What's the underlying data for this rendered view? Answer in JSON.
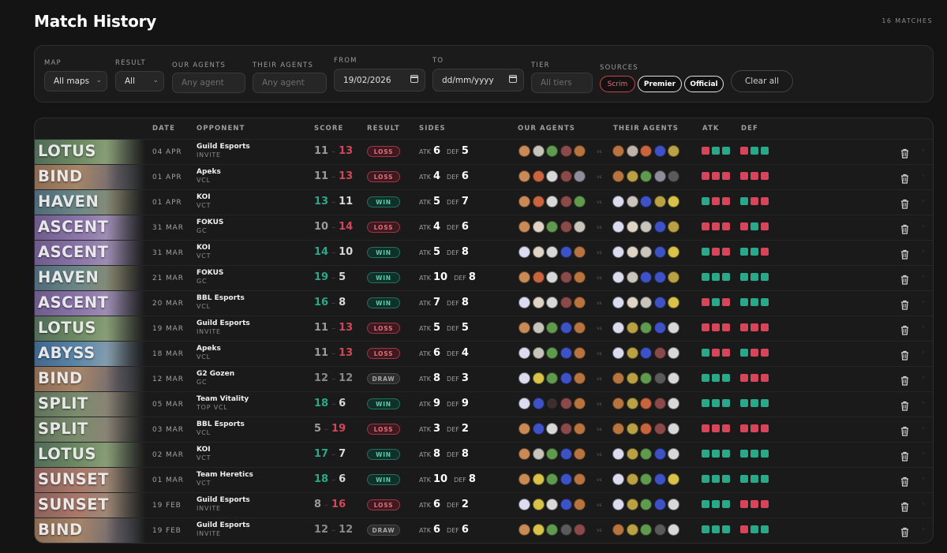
{
  "header": {
    "title": "Match History",
    "match_count": "16 MATCHES"
  },
  "filters": {
    "map_label": "MAP",
    "map_value": "All maps",
    "result_label": "RESULT",
    "result_value": "All",
    "our_agents_label": "OUR AGENTS",
    "our_agents_placeholder": "Any agent",
    "their_agents_label": "THEIR AGENTS",
    "their_agents_placeholder": "Any agent",
    "from_label": "FROM",
    "from_value": "19/02/2026",
    "to_label": "TO",
    "to_placeholder": "dd/mm/yyyy",
    "tier_label": "TIER",
    "tier_placeholder": "All tiers",
    "sources_label": "SOURCES",
    "sources": [
      "Scrim",
      "Premier",
      "Official"
    ],
    "clear_label": "Clear all"
  },
  "columns": {
    "date": "DATE",
    "opponent": "OPPONENT",
    "score": "SCORE",
    "result": "RESULT",
    "sides": "SIDES",
    "our_agents": "OUR AGENTS",
    "their_agents": "THEIR AGENTS",
    "atk": "ATK",
    "def": "DEF"
  },
  "labels": {
    "atk": "ATK",
    "def": "DEF",
    "vs": "vs"
  },
  "colors": {
    "win": "#2aa98a",
    "loss": "#d64559",
    "neutral": "#8a8a8a"
  },
  "matches": [
    {
      "map": "LOTUS",
      "date": "04 APR",
      "opponent": "Guild Esports",
      "league": "INVITE",
      "our": 11,
      "their": 13,
      "result": "LOSS",
      "atk": 6,
      "def": 5,
      "our_agents": [
        "C",
        "K",
        "S",
        "O",
        "B"
      ],
      "their_agents": [
        "B",
        "R",
        "F",
        "N",
        "G"
      ],
      "atk_rounds": "LWW",
      "def_rounds": "LWW"
    },
    {
      "map": "BIND",
      "date": "01 APR",
      "opponent": "Apeks",
      "league": "VCL",
      "our": 11,
      "their": 13,
      "result": "LOSS",
      "atk": 4,
      "def": 6,
      "our_agents": [
        "C",
        "F",
        "W",
        "O",
        "M"
      ],
      "their_agents": [
        "B",
        "G",
        "S",
        "M",
        "T"
      ],
      "atk_rounds": "LLL",
      "def_rounds": "LLL"
    },
    {
      "map": "HAVEN",
      "date": "01 APR",
      "opponent": "KOI",
      "league": "VCT",
      "our": 13,
      "their": 11,
      "result": "WIN",
      "atk": 5,
      "def": 7,
      "our_agents": [
        "C",
        "F",
        "W",
        "O",
        "S"
      ],
      "their_agents": [
        "J",
        "K",
        "N",
        "G",
        "Y"
      ],
      "atk_rounds": "WLL",
      "def_rounds": "WLL"
    },
    {
      "map": "ASCENT",
      "date": "31 MAR",
      "opponent": "FOKUS",
      "league": "GC",
      "our": 10,
      "their": 14,
      "result": "LOSS",
      "atk": 4,
      "def": 6,
      "our_agents": [
        "C",
        "E",
        "S",
        "O",
        "K"
      ],
      "their_agents": [
        "J",
        "E",
        "K",
        "N",
        "G"
      ],
      "atk_rounds": "LLL",
      "def_rounds": "LWL"
    },
    {
      "map": "ASCENT",
      "date": "31 MAR",
      "opponent": "KOI",
      "league": "VCT",
      "our": 14,
      "their": 10,
      "result": "WIN",
      "atk": 5,
      "def": 8,
      "our_agents": [
        "J",
        "E",
        "W",
        "N",
        "B"
      ],
      "their_agents": [
        "J",
        "E",
        "K",
        "N",
        "Y"
      ],
      "atk_rounds": "WLL",
      "def_rounds": "WWL"
    },
    {
      "map": "HAVEN",
      "date": "21 MAR",
      "opponent": "FOKUS",
      "league": "GC",
      "our": 19,
      "their": 5,
      "result": "WIN",
      "atk": 10,
      "def": 8,
      "our_agents": [
        "C",
        "F",
        "W",
        "O",
        "B"
      ],
      "their_agents": [
        "J",
        "K",
        "N",
        "N",
        "G"
      ],
      "atk_rounds": "WWW",
      "def_rounds": "WWW"
    },
    {
      "map": "ASCENT",
      "date": "20 MAR",
      "opponent": "BBL Esports",
      "league": "VCL",
      "our": 16,
      "their": 8,
      "result": "WIN",
      "atk": 7,
      "def": 8,
      "our_agents": [
        "J",
        "E",
        "W",
        "O",
        "B"
      ],
      "their_agents": [
        "J",
        "E",
        "K",
        "N",
        "Y"
      ],
      "atk_rounds": "LWL",
      "def_rounds": "WWW"
    },
    {
      "map": "LOTUS",
      "date": "19 MAR",
      "opponent": "Guild Esports",
      "league": "INVITE",
      "our": 11,
      "their": 13,
      "result": "LOSS",
      "atk": 5,
      "def": 5,
      "our_agents": [
        "C",
        "K",
        "S",
        "N",
        "B"
      ],
      "their_agents": [
        "J",
        "G",
        "S",
        "N",
        "W"
      ],
      "atk_rounds": "LLL",
      "def_rounds": "LLL"
    },
    {
      "map": "ABYSS",
      "date": "18 MAR",
      "opponent": "Apeks",
      "league": "VCL",
      "our": 11,
      "their": 13,
      "result": "LOSS",
      "atk": 6,
      "def": 4,
      "our_agents": [
        "J",
        "K",
        "S",
        "N",
        "B"
      ],
      "their_agents": [
        "J",
        "G",
        "N",
        "O",
        "W"
      ],
      "atk_rounds": "WLL",
      "def_rounds": "WLL"
    },
    {
      "map": "BIND",
      "date": "12 MAR",
      "opponent": "G2 Gozen",
      "league": "GC",
      "our": 12,
      "their": 12,
      "result": "DRAW",
      "atk": 8,
      "def": 3,
      "our_agents": [
        "J",
        "Y",
        "S",
        "N",
        "B"
      ],
      "their_agents": [
        "B",
        "G",
        "S",
        "T",
        "W"
      ],
      "atk_rounds": "WWW",
      "def_rounds": "LLL"
    },
    {
      "map": "SPLIT",
      "date": "05 MAR",
      "opponent": "Team Vitality",
      "league": "TOP VCL",
      "our": 18,
      "their": 6,
      "result": "WIN",
      "atk": 9,
      "def": 9,
      "our_agents": [
        "J",
        "N",
        "A",
        "O",
        "B"
      ],
      "their_agents": [
        "B",
        "G",
        "F",
        "O",
        "W"
      ],
      "atk_rounds": "WWW",
      "def_rounds": "WWW"
    },
    {
      "map": "SPLIT",
      "date": "03 MAR",
      "opponent": "BBL Esports",
      "league": "VCL",
      "our": 5,
      "their": 19,
      "result": "LOSS",
      "atk": 3,
      "def": 2,
      "our_agents": [
        "C",
        "N",
        "W",
        "O",
        "B"
      ],
      "their_agents": [
        "B",
        "G",
        "F",
        "O",
        "W"
      ],
      "atk_rounds": "LLL",
      "def_rounds": "LLL"
    },
    {
      "map": "LOTUS",
      "date": "02 MAR",
      "opponent": "KOI",
      "league": "VCT",
      "our": 17,
      "their": 7,
      "result": "WIN",
      "atk": 8,
      "def": 8,
      "our_agents": [
        "C",
        "K",
        "S",
        "N",
        "B"
      ],
      "their_agents": [
        "J",
        "G",
        "S",
        "N",
        "W"
      ],
      "atk_rounds": "WWW",
      "def_rounds": "WWW"
    },
    {
      "map": "SUNSET",
      "date": "01 MAR",
      "opponent": "Team Heretics",
      "league": "VCT",
      "our": 18,
      "their": 6,
      "result": "WIN",
      "atk": 10,
      "def": 8,
      "our_agents": [
        "C",
        "Y",
        "S",
        "N",
        "B"
      ],
      "their_agents": [
        "J",
        "G",
        "S",
        "N",
        "Y"
      ],
      "atk_rounds": "WWW",
      "def_rounds": "WWW"
    },
    {
      "map": "SUNSET",
      "date": "19 FEB",
      "opponent": "Guild Esports",
      "league": "INVITE",
      "our": 8,
      "their": 16,
      "result": "LOSS",
      "atk": 6,
      "def": 2,
      "our_agents": [
        "J",
        "Y",
        "W",
        "N",
        "B"
      ],
      "their_agents": [
        "J",
        "G",
        "S",
        "N",
        "W"
      ],
      "atk_rounds": "WWW",
      "def_rounds": "LLL"
    },
    {
      "map": "BIND",
      "date": "19 FEB",
      "opponent": "Guild Esports",
      "league": "INVITE",
      "our": 12,
      "their": 12,
      "result": "DRAW",
      "atk": 6,
      "def": 6,
      "our_agents": [
        "C",
        "Y",
        "S",
        "T",
        "O"
      ],
      "their_agents": [
        "B",
        "G",
        "S",
        "T",
        "W"
      ],
      "atk_rounds": "WWW",
      "def_rounds": "LWW"
    }
  ]
}
